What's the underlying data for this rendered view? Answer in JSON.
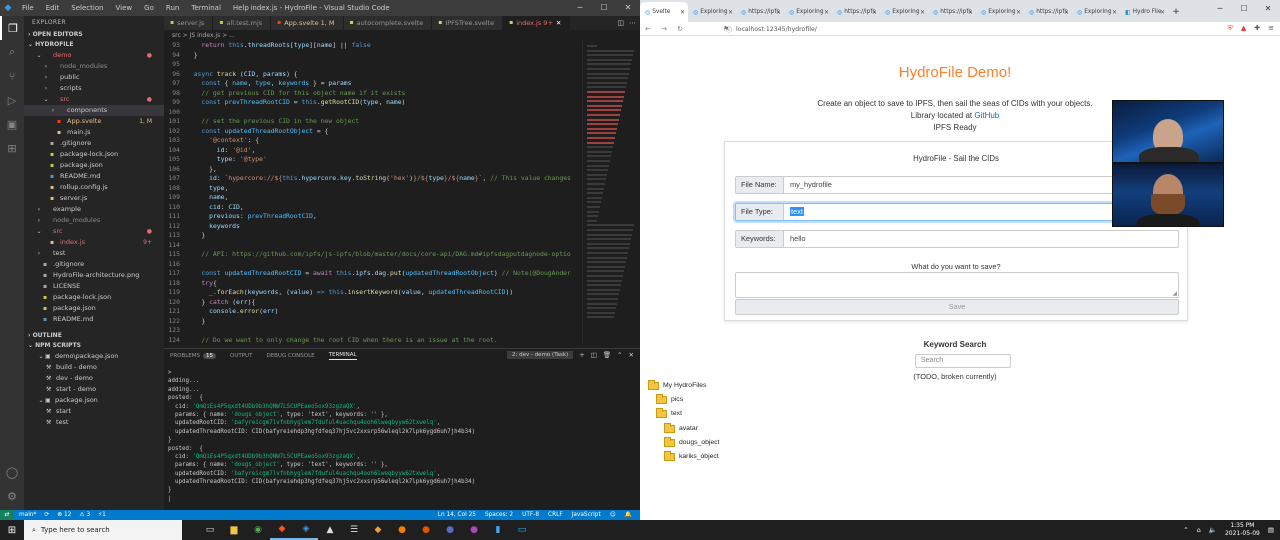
{
  "vscode": {
    "window_title": "index.js - HydroFile - Visual Studio Code",
    "menu": [
      "File",
      "Edit",
      "Selection",
      "View",
      "Go",
      "Run",
      "Terminal",
      "Help"
    ],
    "explorer_title": "EXPLORER",
    "open_editors": "OPEN EDITORS",
    "project": "HYDROFILE",
    "files": [
      {
        "name": "demo",
        "type": "folder",
        "indent": 1,
        "open": true,
        "color": "red",
        "badge": "●"
      },
      {
        "name": "node_modules",
        "type": "folder",
        "indent": 2,
        "open": false,
        "color": "gray",
        "badge": ""
      },
      {
        "name": "public",
        "type": "folder",
        "indent": 2,
        "open": false,
        "color": "",
        "badge": ""
      },
      {
        "name": "scripts",
        "type": "folder",
        "indent": 2,
        "open": false,
        "color": "",
        "badge": ""
      },
      {
        "name": "src",
        "type": "folder",
        "indent": 2,
        "open": true,
        "color": "red",
        "badge": "●"
      },
      {
        "name": "components",
        "type": "folder",
        "indent": 3,
        "open": false,
        "color": "",
        "badge": "",
        "sel": true
      },
      {
        "name": "App.svelte",
        "type": "file",
        "indent": 3,
        "color": "mod",
        "badge": "1, M"
      },
      {
        "name": "main.js",
        "type": "file",
        "indent": 3,
        "color": "",
        "badge": ""
      },
      {
        "name": ".gitignore",
        "type": "file",
        "indent": 2,
        "color": "",
        "badge": ""
      },
      {
        "name": "package-lock.json",
        "type": "file",
        "indent": 2,
        "color": "",
        "badge": ""
      },
      {
        "name": "package.json",
        "type": "file",
        "indent": 2,
        "color": "",
        "badge": ""
      },
      {
        "name": "README.md",
        "type": "file",
        "indent": 2,
        "color": "",
        "badge": ""
      },
      {
        "name": "rollup.config.js",
        "type": "file",
        "indent": 2,
        "color": "",
        "badge": ""
      },
      {
        "name": "server.js",
        "type": "file",
        "indent": 2,
        "color": "",
        "badge": ""
      },
      {
        "name": "example",
        "type": "folder",
        "indent": 1,
        "open": false,
        "color": "",
        "badge": ""
      },
      {
        "name": "node_modules",
        "type": "folder",
        "indent": 1,
        "open": false,
        "color": "gray",
        "badge": ""
      },
      {
        "name": "src",
        "type": "folder",
        "indent": 1,
        "open": true,
        "color": "red",
        "badge": "●"
      },
      {
        "name": "index.js",
        "type": "file",
        "indent": 2,
        "color": "red",
        "badge": "9+"
      },
      {
        "name": "test",
        "type": "folder",
        "indent": 1,
        "open": false,
        "color": "",
        "badge": ""
      },
      {
        "name": ".gitignore",
        "type": "file",
        "indent": 1,
        "color": "",
        "badge": ""
      },
      {
        "name": "HydroFile-architecture.png",
        "type": "file",
        "indent": 1,
        "color": "",
        "badge": ""
      },
      {
        "name": "LICENSE",
        "type": "file",
        "indent": 1,
        "color": "",
        "badge": ""
      },
      {
        "name": "package-lock.json",
        "type": "file",
        "indent": 1,
        "color": "",
        "badge": ""
      },
      {
        "name": "package.json",
        "type": "file",
        "indent": 1,
        "color": "",
        "badge": ""
      },
      {
        "name": "README.md",
        "type": "file",
        "indent": 1,
        "color": "",
        "badge": ""
      }
    ],
    "outline": "OUTLINE",
    "npm_scripts": "NPM SCRIPTS",
    "npm_items": [
      {
        "name": "demo\\package.json",
        "indent": 1,
        "kind": "pkg"
      },
      {
        "name": "build - demo",
        "indent": 2,
        "kind": "script"
      },
      {
        "name": "dev - demo",
        "indent": 2,
        "kind": "script"
      },
      {
        "name": "start - demo",
        "indent": 2,
        "kind": "script"
      },
      {
        "name": "package.json",
        "indent": 1,
        "kind": "pkg"
      },
      {
        "name": "start",
        "indent": 2,
        "kind": "script"
      },
      {
        "name": "test",
        "indent": 2,
        "kind": "script"
      }
    ],
    "tabs": [
      {
        "label": "server.js",
        "active": false,
        "color": "yel"
      },
      {
        "label": "all.test.mjs",
        "active": false,
        "color": "yel"
      },
      {
        "label": "App.svelte 1, M",
        "active": false,
        "color": "mod"
      },
      {
        "label": "autocomplete.svelte",
        "active": false,
        "color": "red"
      },
      {
        "label": "IPFSTree.svelte",
        "active": false,
        "color": "red"
      },
      {
        "label": "index.js 9+",
        "active": true,
        "color": "red"
      }
    ],
    "breadcrumb": "src > JS index.js > ...",
    "code_lines": [
      {
        "n": "93",
        "html": "    <span class='kp'>return</span> <span class='k'>this</span>.<span class='v'>threadRoots</span>[<span class='v'>type</span>][<span class='v'>name</span>] || <span class='k'>false</span>"
      },
      {
        "n": "94",
        "html": "  }"
      },
      {
        "n": "95",
        "html": ""
      },
      {
        "n": "96",
        "html": "  <span class='k'>async</span> <span class='f'>track</span> (<span class='v'>CID</span>, <span class='v'>params</span>) {"
      },
      {
        "n": "97",
        "html": "    <span class='k'>const</span> { <span class='cn'>name</span>, <span class='cn'>type</span>, <span class='cn'>keywords</span> } = <span class='v'>params</span>"
      },
      {
        "n": "98",
        "html": "    <span class='cm'>// get previous CID for this object name if it exists</span>"
      },
      {
        "n": "99",
        "html": "    <span class='k'>const</span> <span class='cn'>prevThreadRootCID</span> = <span class='k'>this</span>.<span class='f'>getRootCID</span>(<span class='v'>type</span>, <span class='v'>name</span>)"
      },
      {
        "n": "100",
        "html": ""
      },
      {
        "n": "101",
        "html": "    <span class='cm'>// set the previous CID in the new object</span>"
      },
      {
        "n": "102",
        "html": "    <span class='k'>const</span> <span class='cn'>updatedThreadRootObject</span> = {"
      },
      {
        "n": "103",
        "html": "      <span class='s'>'@context'</span>: {"
      },
      {
        "n": "104",
        "html": "        <span class='v'>id</span>: <span class='s'>'@id'</span>,"
      },
      {
        "n": "105",
        "html": "        <span class='v'>type</span>: <span class='s'>'@type'</span>"
      },
      {
        "n": "106",
        "html": "      },"
      },
      {
        "n": "107",
        "html": "      <span class='v'>id</span>: <span class='s'>`hypercore://${</span><span class='k'>this</span>.<span class='v'>hypercore</span>.<span class='v'>key</span>.<span class='f'>toString</span>(<span class='s'>'hex'</span>)<span class='s'>}/${</span><span class='v'>type</span><span class='s'>}/${</span><span class='v'>name</span><span class='s'>}`</span>, <span class='cm'>// This value changes</span>"
      },
      {
        "n": "108",
        "html": "      <span class='v'>type</span>,"
      },
      {
        "n": "109",
        "html": "      <span class='v'>name</span>,"
      },
      {
        "n": "110",
        "html": "      <span class='v'>cid</span>: <span class='v'>CID</span>,"
      },
      {
        "n": "111",
        "html": "      <span class='v'>previous</span>: <span class='cn'>prevThreadRootCID</span>,"
      },
      {
        "n": "112",
        "html": "      <span class='v'>keywords</span>"
      },
      {
        "n": "113",
        "html": "    }"
      },
      {
        "n": "114",
        "html": ""
      },
      {
        "n": "115",
        "html": "    <span class='cm'>// API: https://github.com/ipfs/js-ipfs/blob/master/docs/core-api/DAG.md#ipfsdagputdagnode-optio</span>"
      },
      {
        "n": "116",
        "html": ""
      },
      {
        "n": "117",
        "html": "    <span class='k'>const</span> <span class='cn'>updatedThreadRootCID</span> = <span class='kp'>await</span> <span class='k'>this</span>.<span class='v'>ipfs</span>.<span class='v'>dag</span>.<span class='f'>put</span>(<span class='cn'>updatedThreadRootObject</span>) <span class='cm'>// Note(@DougAnder</span>"
      },
      {
        "n": "118",
        "html": "    <span class='kp'>try</span>{"
      },
      {
        "n": "119",
        "html": "      <span class='v'>_</span>.<span class='f'>forEach</span>(<span class='v'>keywords</span>, (<span class='v'>value</span>) <span class='k'>=&gt;</span> <span class='k'>this</span>.<span class='f'>insertKeyword</span>(<span class='v'>value</span>, <span class='cn'>updatedThreadRootCID</span>))"
      },
      {
        "n": "120",
        "html": "    } <span class='kp'>catch</span> (<span class='v'>err</span>){"
      },
      {
        "n": "121",
        "html": "      <span class='v'>console</span>.<span class='f'>error</span>(<span class='v'>err</span>)"
      },
      {
        "n": "122",
        "html": "    }"
      },
      {
        "n": "123",
        "html": ""
      },
      {
        "n": "124",
        "html": "    <span class='cm'>// Do we want to only change the root CID when there is an issue at the root.</span>"
      }
    ],
    "panel_tabs": [
      "PROBLEMS",
      "OUTPUT",
      "DEBUG CONSOLE",
      "TERMINAL"
    ],
    "problems_count": "15",
    "terminal_select": "2: dev - demo (Task)",
    "terminal_lines": [
      {
        "t": ">"
      },
      {
        "t": "adding..."
      },
      {
        "t": "adding..."
      },
      {
        "t": "posted:  {"
      },
      {
        "t": "  cid: ",
        "g": "'QmQiEs4P5qxdt4UDb9b3hQNW7LSCUPEaeo5ox93zgzaQX'",
        "r": ","
      },
      {
        "t": "  params: { name: ",
        "g": "'dougs_object'",
        "r": ", type: 'text', keywords: '' },"
      },
      {
        "t": "  updatedRootCID: ",
        "g": "'bafyreicgm7lvfnbhyglem7fduful4uachqu4ooh6lweqbyyw62txwelq'",
        "r": ","
      },
      {
        "t": "  updatedThreadRootCID: CID(bafyreiehdp3hgfdfeq37hj5vc2xxsrp56wleql2k7lpk6ygd6uh7jh4b34)"
      },
      {
        "t": "}"
      },
      {
        "t": "posted:  {"
      },
      {
        "t": "  cid: ",
        "g": "'QmQiEs4P5qxdt4UDb9b3hQNW7LSCUPEaeo5ox93zgzaQX'",
        "r": ","
      },
      {
        "t": "  params: { name: ",
        "g": "'dougs_object'",
        "r": ", type: 'text', keywords: '' },"
      },
      {
        "t": "  updatedRootCID: ",
        "g": "'bafyreicgm7lvfnbhyglem7fduful4uachqu4ooh6lweqbyyw62txwelq'",
        "r": ","
      },
      {
        "t": "  updatedThreadRootCID: CID(bafyreiehdp3hgfdfeq37hj5vc2xxsrp56wleql2k7lpk6ygd6uh7jh4b34)"
      },
      {
        "t": "}"
      },
      {
        "t": "|"
      }
    ],
    "status": {
      "branch": "main*",
      "sync": "⟳",
      "errors": "⊗ 12",
      "warnings": "⚠ 3",
      "ports": "⚡1",
      "position": "Ln 14, Col 25",
      "spaces": "Spaces: 2",
      "encoding": "UTF-8",
      "eol": "CRLF",
      "lang": "JavaScript"
    }
  },
  "browser": {
    "tabs": [
      {
        "label": "Svelte",
        "active": true
      },
      {
        "label": "Exploring",
        "active": false
      },
      {
        "label": "https://ipfs",
        "active": false
      },
      {
        "label": "Exploring",
        "active": false
      },
      {
        "label": "https://ipfs",
        "active": false
      },
      {
        "label": "Exploring",
        "active": false
      },
      {
        "label": "https://ipfs",
        "active": false
      },
      {
        "label": "Exploring",
        "active": false
      },
      {
        "label": "https://ipfs",
        "active": false
      },
      {
        "label": "Exploring",
        "active": false
      },
      {
        "label": "Hydro File",
        "active": false
      }
    ],
    "url": "localhost:12345/hydrofile/",
    "page": {
      "title": "HydroFile Demo!",
      "intro_line1": "Create an object to save to IPFS, then sail the seas of CIDs with your objects.",
      "intro_line2_prefix": "Library located at ",
      "intro_link": "GitHub",
      "intro_line3": "IPFS Ready",
      "card_title": "HydroFile - Sail the CIDs",
      "fields": [
        {
          "label": "File Name:",
          "value": "my_hydrofile",
          "focus": false,
          "placeholder": false
        },
        {
          "label": "File Type:",
          "value": "text",
          "focus": true,
          "placeholder": false
        },
        {
          "label": "Keywords:",
          "value": "hello",
          "focus": false,
          "placeholder": false
        }
      ],
      "what_label": "What do you want to save?",
      "save_button": "Save",
      "keyword_title": "Keyword Search",
      "search_placeholder": "Search",
      "todo": "(TODO, broken currently)",
      "tree": [
        {
          "label": "My HydroFiles",
          "indent": 0
        },
        {
          "label": "pics",
          "indent": 1
        },
        {
          "label": "text",
          "indent": 1
        },
        {
          "label": "avatar",
          "indent": 2
        },
        {
          "label": "dougs_object",
          "indent": 2
        },
        {
          "label": "kariks_object",
          "indent": 2
        }
      ]
    }
  },
  "taskbar": {
    "search_placeholder": "Type here to search",
    "time": "1:35 PM",
    "date": "2021-05-09"
  }
}
